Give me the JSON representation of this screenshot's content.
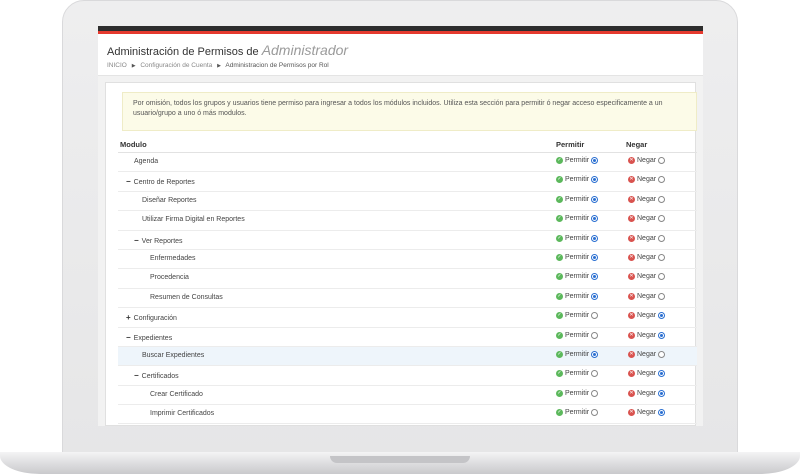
{
  "header": {
    "title": "Administración de Permisos de",
    "role": "Administrador"
  },
  "breadcrumb": {
    "home": "INICIO",
    "account": "Configuración de Cuenta",
    "current": "Administracion de Permisos por Rol"
  },
  "info": {
    "text": "Por omisión, todos los grupos y usuarios tiene permiso para ingresar a todos los módulos incluidos. Utiliza esta sección para permitir ó negar acceso especificamente a un usuario/grupo a uno ó más modulos."
  },
  "table": {
    "col_module": "Modulo",
    "col_allow": "Permitir",
    "col_deny": "Negar",
    "allow_label": "Permitir",
    "deny_label": "Negar",
    "rows": [
      {
        "label": "Agenda",
        "level": 0,
        "toggle": "",
        "value": "allow",
        "highlight": false
      },
      {
        "label": "Centro de Reportes",
        "level": 0,
        "toggle": "−",
        "value": "allow",
        "highlight": false
      },
      {
        "label": "Diseñar Reportes",
        "level": 1,
        "toggle": "",
        "value": "allow",
        "highlight": false
      },
      {
        "label": "Utilizar Firma Digital en Reportes",
        "level": 1,
        "toggle": "",
        "value": "allow",
        "highlight": false
      },
      {
        "label": "Ver Reportes",
        "level": 1,
        "toggle": "−",
        "value": "allow",
        "highlight": false
      },
      {
        "label": "Enfermedades",
        "level": 2,
        "toggle": "",
        "value": "allow",
        "highlight": false
      },
      {
        "label": "Procedencia",
        "level": 2,
        "toggle": "",
        "value": "allow",
        "highlight": false
      },
      {
        "label": "Resumen de Consultas",
        "level": 2,
        "toggle": "",
        "value": "allow",
        "highlight": false
      },
      {
        "label": "Configuración",
        "level": 0,
        "toggle": "+",
        "value": "deny",
        "highlight": false
      },
      {
        "label": "Expedientes",
        "level": 0,
        "toggle": "−",
        "value": "deny",
        "highlight": false
      },
      {
        "label": "Buscar Expedientes",
        "level": 1,
        "toggle": "",
        "value": "allow",
        "highlight": true
      },
      {
        "label": "Certificados",
        "level": 1,
        "toggle": "−",
        "value": "deny",
        "highlight": false
      },
      {
        "label": "Crear Certificado",
        "level": 2,
        "toggle": "",
        "value": "deny",
        "highlight": false
      },
      {
        "label": "Imprimir Certificados",
        "level": 2,
        "toggle": "",
        "value": "deny",
        "highlight": false
      }
    ]
  },
  "colors": {
    "accent_red": "#e53a2e",
    "allow_green": "#5cb85c",
    "deny_red": "#d9534f",
    "radio_blue": "#2a6fd1",
    "info_bg": "#fcfbe8"
  },
  "icons": {
    "allow": "check-circle-icon",
    "deny": "x-circle-icon"
  }
}
